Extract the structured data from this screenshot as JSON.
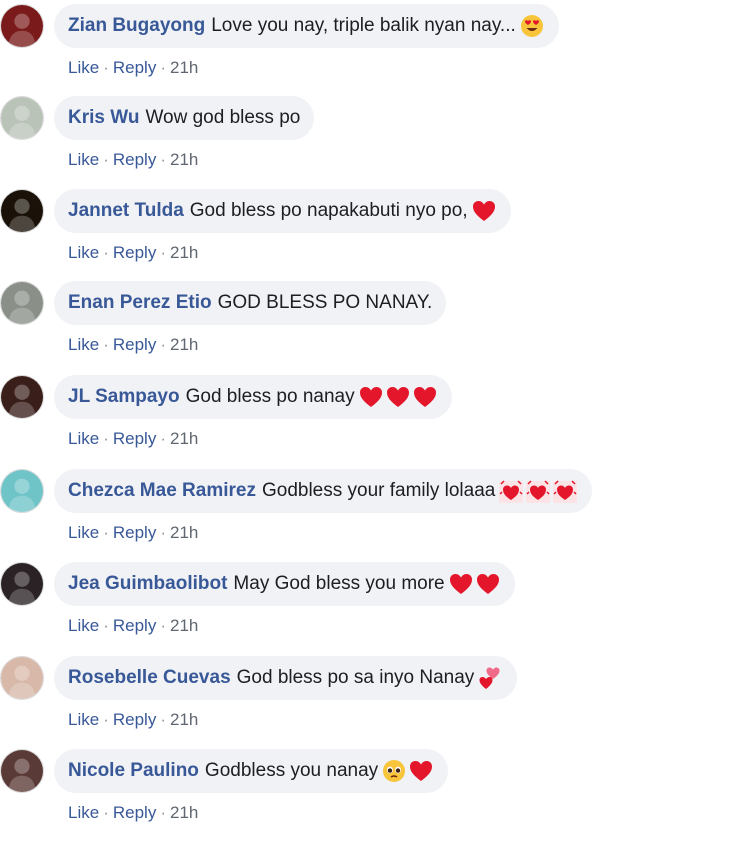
{
  "comments": [
    {
      "author": "Zian Bugayong",
      "text": "Love you nay, triple balik nyan nay...",
      "emojis": [
        "heart-eyes-face"
      ],
      "like": "Like",
      "reply": "Reply",
      "time": "21h",
      "avatar_color": "#7a1a1a"
    },
    {
      "author": "Kris Wu",
      "text": "Wow god bless po",
      "emojis": [],
      "like": "Like",
      "reply": "Reply",
      "time": "21h",
      "avatar_color": "#b9c3b8"
    },
    {
      "author": "Jannet Tulda",
      "text": "God bless po napakabuti nyo po,",
      "emojis": [
        "red-heart"
      ],
      "like": "Like",
      "reply": "Reply",
      "time": "21h",
      "avatar_color": "#1a1208"
    },
    {
      "author": "Enan Perez Etio",
      "text": "GOD BLESS PO NANAY.",
      "emojis": [],
      "like": "Like",
      "reply": "Reply",
      "time": "21h",
      "avatar_color": "#8a8f88"
    },
    {
      "author": "JL Sampayo",
      "text": "God bless po nanay",
      "emojis": [
        "red-heart",
        "red-heart",
        "red-heart"
      ],
      "like": "Like",
      "reply": "Reply",
      "time": "21h",
      "avatar_color": "#3a1e1a"
    },
    {
      "author": "Chezca Mae Ramirez",
      "text": "Godbless your family lolaaa",
      "emojis": [
        "revolving-hearts",
        "revolving-hearts",
        "revolving-hearts"
      ],
      "like": "Like",
      "reply": "Reply",
      "time": "21h",
      "avatar_color": "#6fc4c8"
    },
    {
      "author": "Jea Guimbaolibot",
      "text": "May God bless you more",
      "emojis": [
        "red-heart",
        "red-heart"
      ],
      "like": "Like",
      "reply": "Reply",
      "time": "21h",
      "avatar_color": "#2a2224"
    },
    {
      "author": "Rosebelle Cuevas",
      "text": "God bless po sa inyo Nanay",
      "emojis": [
        "two-hearts"
      ],
      "like": "Like",
      "reply": "Reply",
      "time": "21h",
      "avatar_color": "#d8b8a8"
    },
    {
      "author": "Nicole Paulino",
      "text": "Godbless you nanay",
      "emojis": [
        "pleading-face",
        "red-heart"
      ],
      "like": "Like",
      "reply": "Reply",
      "time": "21h",
      "avatar_color": "#5a3a36"
    }
  ]
}
